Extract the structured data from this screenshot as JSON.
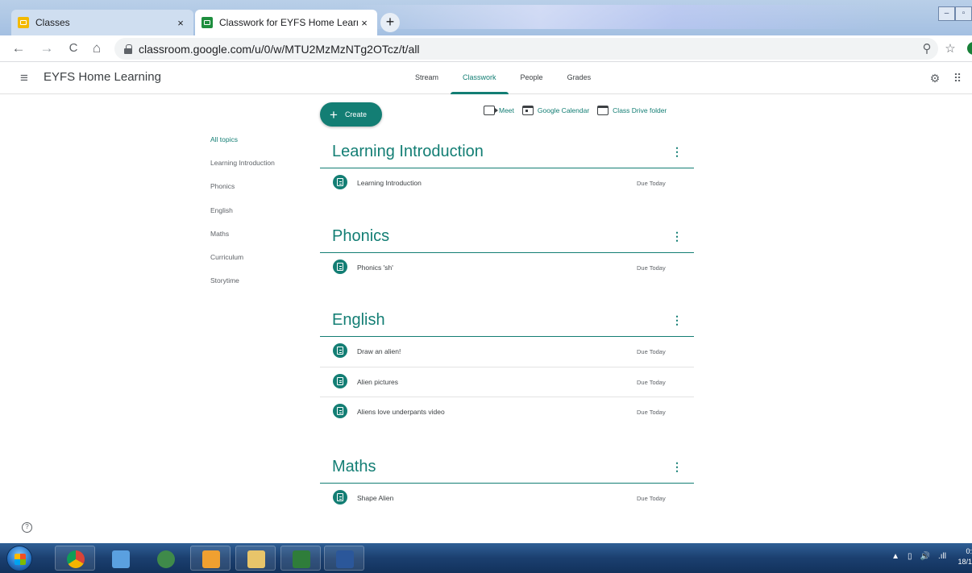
{
  "browser": {
    "tabs": [
      {
        "title": "Classes",
        "close": "×"
      },
      {
        "title": "Classwork for EYFS Home Learning",
        "close": "×"
      }
    ],
    "new_tab": "+",
    "nav": {
      "back": "←",
      "forward": "→",
      "reload": "C",
      "home": "⌂"
    },
    "url": "classroom.google.com/u/0/w/MTU2MzMzNTg2OTcz/t/all",
    "toolbar_icons": {
      "zoom": "⚲",
      "bookmark": "☆"
    }
  },
  "header": {
    "menu_icon": "≡",
    "class_name": "EYFS Home Learning",
    "tabs": [
      {
        "label": "Stream"
      },
      {
        "label": "Classwork"
      },
      {
        "label": "People"
      },
      {
        "label": "Grades"
      }
    ],
    "settings_icon": "⚙",
    "apps_icon": "⠿"
  },
  "actions": {
    "create_plus": "+",
    "create_label": "Create",
    "meet_label": "Meet",
    "calendar_label": "Google Calendar",
    "drive_label": "Class Drive folder"
  },
  "topics": [
    {
      "label": "All topics"
    },
    {
      "label": "Learning Introduction"
    },
    {
      "label": "Phonics"
    },
    {
      "label": "English"
    },
    {
      "label": "Maths"
    },
    {
      "label": "Curriculum"
    },
    {
      "label": "Storytime"
    }
  ],
  "sections": [
    {
      "title": "Learning Introduction",
      "menu": "⋮",
      "items": [
        {
          "title": "Learning Introduction",
          "due": "Due Today"
        }
      ]
    },
    {
      "title": "Phonics",
      "menu": "⋮",
      "items": [
        {
          "title": "Phonics 'sh'",
          "due": "Due Today"
        }
      ]
    },
    {
      "title": "English",
      "menu": "⋮",
      "items": [
        {
          "title": "Draw an alien!",
          "due": "Due Today"
        },
        {
          "title": "Alien pictures",
          "due": "Due Today"
        },
        {
          "title": "Aliens love underpants video",
          "due": "Due Today"
        }
      ]
    },
    {
      "title": "Maths",
      "menu": "⋮",
      "items": [
        {
          "title": "Shape Alien",
          "due": "Due Today"
        }
      ]
    }
  ],
  "help_icon": "?",
  "taskbar": {
    "tray": {
      "arrow": "▲",
      "volume": "🔊",
      "signal": ".ıll"
    },
    "clock": {
      "time": "0:",
      "date": "18/1"
    }
  },
  "colors": {
    "accent": "#137e74",
    "taskbar": "#1b3f6f"
  }
}
